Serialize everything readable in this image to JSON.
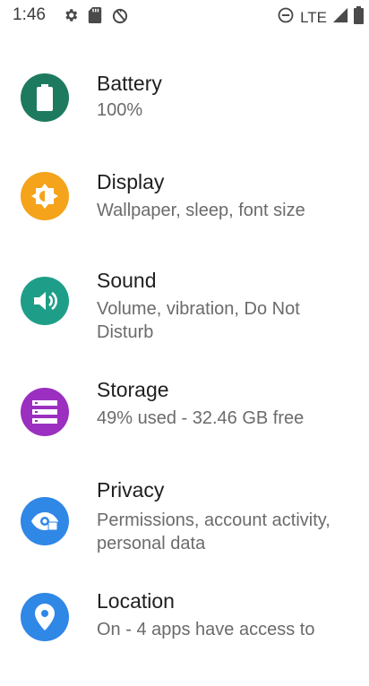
{
  "status_bar": {
    "time": "1:46",
    "left_icons": [
      "settings-gear-icon",
      "sd-card-icon",
      "no-sync-icon"
    ],
    "right_icons": [
      "do-not-disturb-icon",
      "signal-icon",
      "battery-icon"
    ],
    "network": "LTE"
  },
  "settings": {
    "items": [
      {
        "title": "Battery",
        "subtitle": "100%",
        "icon": "battery-icon",
        "color": "#1e7a5f"
      },
      {
        "title": "Display",
        "subtitle": "Wallpaper, sleep, font size",
        "icon": "brightness-icon",
        "color": "#f4a31b"
      },
      {
        "title": "Sound",
        "subtitle": "Volume, vibration, Do Not Disturb",
        "icon": "volume-icon",
        "color": "#1e9e88"
      },
      {
        "title": "Storage",
        "subtitle": "49% used - 32.46 GB free",
        "icon": "storage-icon",
        "color": "#9b2fc0"
      },
      {
        "title": "Privacy",
        "subtitle": "Permissions, account activity, personal data",
        "icon": "eye-icon",
        "color": "#2f87e6"
      },
      {
        "title": "Location",
        "subtitle": "On - 4 apps have access to",
        "icon": "location-pin-icon",
        "color": "#2f87e6"
      }
    ]
  }
}
